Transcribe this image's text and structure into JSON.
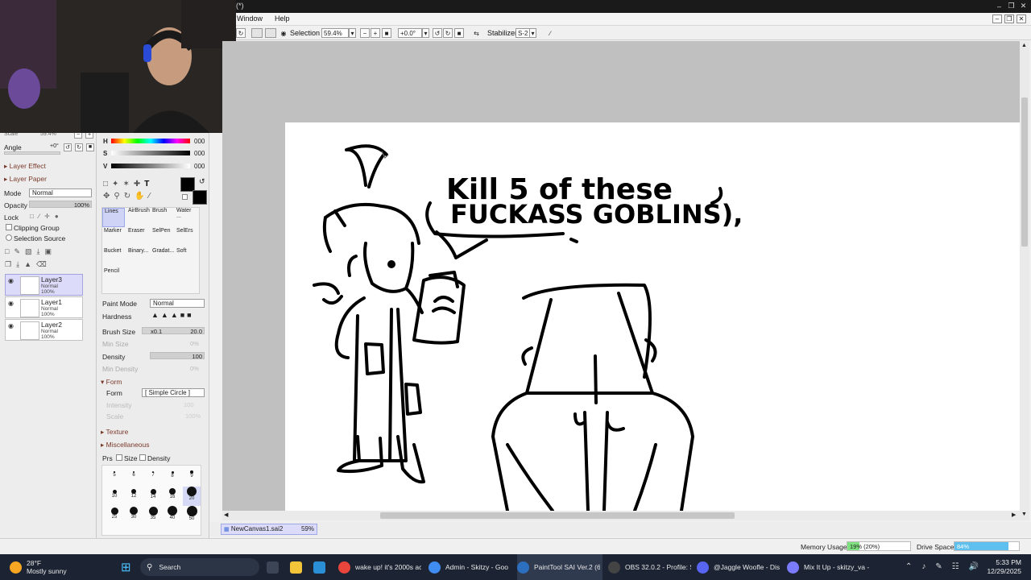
{
  "app": {
    "title_suffix": "(*)"
  },
  "menu": {
    "window": "Window",
    "help": "Help"
  },
  "toolbar": {
    "selection_label": "Selection",
    "zoom": "59.4%",
    "rotation": "+0.0°",
    "stabilizer_label": "Stabilizer",
    "stabilizer_value": "S-2"
  },
  "navigator": {
    "scale_label": "Scale",
    "scale_value": "59.4%",
    "angle_label": "Angle",
    "angle_value": "+0°"
  },
  "layer_panel": {
    "layer_effect": "Layer Effect",
    "layer_paper": "Layer Paper",
    "mode_label": "Mode",
    "mode_value": "Normal",
    "opacity_label": "Opacity",
    "opacity_value": "100%",
    "lock_label": "Lock",
    "clipping_group": "Clipping Group",
    "selection_source": "Selection Source",
    "layers": [
      {
        "name": "Layer3",
        "mode": "Normal",
        "opacity": "100%"
      },
      {
        "name": "Layer1",
        "mode": "Normal",
        "opacity": "100%"
      },
      {
        "name": "Layer2",
        "mode": "Normal",
        "opacity": "100%"
      }
    ]
  },
  "color": {
    "h_label": "H",
    "h_value": "000",
    "s_label": "S",
    "s_value": "000",
    "v_label": "V",
    "v_value": "000"
  },
  "tools": [
    "Lines",
    "AirBrush",
    "Brush",
    "Water ...",
    "Marker",
    "Eraser",
    "SelPen",
    "SelErs",
    "Bucket",
    "Binary...",
    "Gradat...",
    "Soft",
    "Pencil"
  ],
  "brush": {
    "paint_mode_label": "Paint Mode",
    "paint_mode_value": "Normal",
    "hardness_label": "Hardness",
    "brush_size_label": "Brush Size",
    "brush_size_mult": "x0.1",
    "brush_size_value": "20.0",
    "min_size_label": "Min Size",
    "min_size_value": "0%",
    "density_label": "Density",
    "density_value": "100",
    "min_density_label": "Min Density",
    "min_density_value": "0%",
    "form_section": "Form",
    "form_label": "Form",
    "form_value": "[ Simple Circle ]",
    "intensity_label": "Intensity",
    "intensity_value": "100",
    "scale_label": "Scale",
    "scale_value": "100%",
    "texture_section": "Texture",
    "misc_section": "Miscellaneous",
    "prs_label": "Prs",
    "size_check": "Size",
    "density_check": "Density",
    "presets": [
      "5",
      "6",
      "7",
      "8",
      "9",
      "10",
      "12",
      "14",
      "16",
      "20",
      "25",
      "30",
      "35",
      "40",
      "50"
    ]
  },
  "canvas": {
    "speech_line1": "Kill 5 of these",
    "speech_line2": "FUCKASS GOBLINS),"
  },
  "file_tab": {
    "name": "NewCanvas1.sai2",
    "zoom": "59%"
  },
  "status": {
    "memory_label": "Memory Usage",
    "memory_value": "19% (20%)",
    "memory_fraction": 0.19,
    "drive_label": "Drive Space",
    "drive_value": "84%",
    "drive_fraction": 0.84
  },
  "taskbar": {
    "weather_temp": "28°F",
    "weather_desc": "Mostly sunny",
    "search_label": "Search",
    "apps": [
      {
        "label": "wake up! it's 2000s ac",
        "icon": "chrome-icon",
        "color": "#e8453c"
      },
      {
        "label": "Admin - Skitzy - Goo",
        "icon": "chrome-icon",
        "color": "#3f8df0"
      },
      {
        "label": "PaintTool SAI Ver.2 (6",
        "icon": "painttool-sai-icon",
        "color": "#2d6fbf"
      },
      {
        "label": "OBS 32.0.2 - Profile: S",
        "icon": "obs-icon",
        "color": "#444444"
      },
      {
        "label": "@Jaggle Woofle - Dis",
        "icon": "discord-icon",
        "color": "#5865f2"
      },
      {
        "label": "Mix It Up - skitzy_va -",
        "icon": "mixitup-icon",
        "color": "#7b7bff"
      }
    ],
    "time": "5:33 PM",
    "date": "12/29/2025"
  }
}
